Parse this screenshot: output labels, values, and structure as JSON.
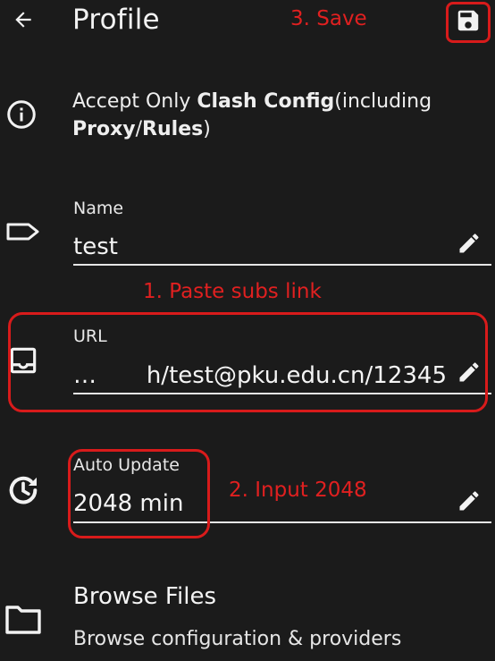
{
  "header": {
    "title": "Profile"
  },
  "notice": {
    "prefix": "Accept Only ",
    "bold1": "Clash Config",
    "middle": "(including ",
    "bold2": "Proxy",
    "slash": "/",
    "bold3": "Rules",
    "suffix": ")"
  },
  "fields": {
    "name": {
      "label": "Name",
      "value": "test"
    },
    "url": {
      "label": "URL",
      "value_prefix": "…",
      "value": "h/test@pku.edu.cn/12345"
    },
    "auto_update": {
      "label": "Auto Update",
      "value": "2048 min"
    }
  },
  "browse": {
    "title": "Browse Files",
    "subtitle": "Browse configuration & providers"
  },
  "annotations": {
    "save": "3. Save",
    "paste": "1. Paste subs link",
    "input": "2. Input 2048",
    "color": "#e02020"
  },
  "icons": {
    "back": "arrow-back-icon",
    "save": "save-floppy-icon",
    "info": "info-circle-icon",
    "name": "label-tag-icon",
    "url": "inbox-tray-icon",
    "update": "update-history-icon",
    "edit": "pencil-edit-icon",
    "folder": "folder-icon"
  }
}
